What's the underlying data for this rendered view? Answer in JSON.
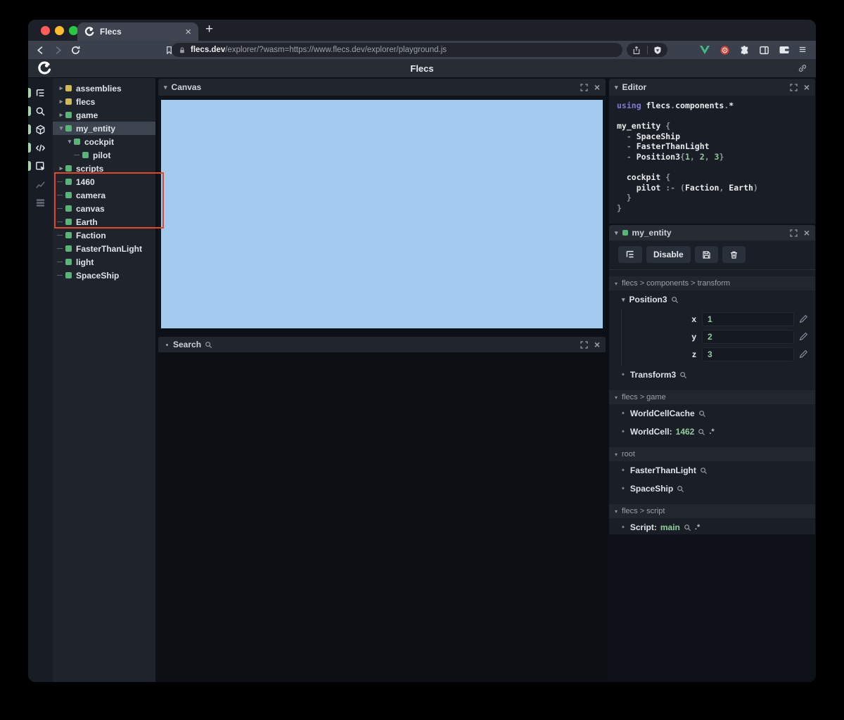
{
  "browser": {
    "tab_title": "Flecs",
    "url_domain": "flecs.dev",
    "url_path": "/explorer/?wasm=https://www.flecs.dev/explorer/playground.js"
  },
  "icons": {
    "close": "×",
    "new_tab": "+",
    "menu": "≡",
    "collapsed_arrow": "▸",
    "expanded_arrow": "▾",
    "bullet": "•",
    "names": [
      "flecs-logo-icon",
      "back-icon",
      "forward-icon",
      "reload-icon",
      "bookmark-icon",
      "lock-icon",
      "share-icon",
      "shield-icon",
      "vue-extension-icon",
      "red-extension-icon",
      "puzzle-icon",
      "sidebar-toggle-icon",
      "wallet-icon",
      "menu-icon",
      "link-icon",
      "tree-icon",
      "search-icon",
      "cube-icon",
      "code-icon",
      "inspector-icon",
      "chart-icon",
      "logs-icon",
      "fullscreen-icon",
      "close-icon",
      "magnifier-icon",
      "pencil-icon",
      "save-icon",
      "trash-icon"
    ]
  },
  "colors": {
    "canvas_blue": "#a3cbf0",
    "annotation_red": "#e0482e",
    "square_green": "#57b578",
    "square_yellow": "#d3ba50",
    "value_green": "#93cb9f",
    "keyword_purple": "#8478cf",
    "vue_green": "#42b883",
    "traffic_red": "#ff5e57",
    "traffic_yellow": "#fdbc2e",
    "traffic_green": "#2ac840"
  },
  "app": {
    "header": {
      "title": "Flecs"
    },
    "tree": {
      "items": [
        {
          "label": "assemblies",
          "square": "yellow",
          "state": "collapsed",
          "indent": 0
        },
        {
          "label": "flecs",
          "square": "yellow",
          "state": "collapsed",
          "indent": 0
        },
        {
          "label": "game",
          "square": "green",
          "state": "collapsed",
          "indent": 0
        },
        {
          "label": "my_entity",
          "square": "green",
          "state": "expanded",
          "indent": 0,
          "selected": true
        },
        {
          "label": "cockpit",
          "square": "green",
          "state": "expanded",
          "indent": 1
        },
        {
          "label": "pilot",
          "square": "green",
          "state": "leaf",
          "indent": 2
        },
        {
          "label": "scripts",
          "square": "green",
          "state": "collapsed",
          "indent": 0
        },
        {
          "label": "1460",
          "square": "green",
          "state": "leaf",
          "indent": 0
        },
        {
          "label": "camera",
          "square": "green",
          "state": "leaf",
          "indent": 0
        },
        {
          "label": "canvas",
          "square": "green",
          "state": "leaf",
          "indent": 0
        },
        {
          "label": "Earth",
          "square": "green",
          "state": "leaf",
          "indent": 0
        },
        {
          "label": "Faction",
          "square": "green",
          "state": "leaf",
          "indent": 0
        },
        {
          "label": "FasterThanLight",
          "square": "green",
          "state": "leaf",
          "indent": 0
        },
        {
          "label": "light",
          "square": "green",
          "state": "leaf",
          "indent": 0
        },
        {
          "label": "SpaceShip",
          "square": "green",
          "state": "leaf",
          "indent": 0
        }
      ]
    },
    "canvas_panel": {
      "title": "Canvas"
    },
    "search_panel": {
      "title": "Search"
    },
    "editor_panel": {
      "title": "Editor",
      "lines": [
        [
          [
            "using ",
            "kw"
          ],
          [
            "flecs",
            "id"
          ],
          [
            ".",
            "pn"
          ],
          [
            "components",
            "id"
          ],
          [
            ".",
            "pn"
          ],
          [
            "*",
            "id"
          ]
        ],
        [],
        [
          [
            "my_entity ",
            "id"
          ],
          [
            "{",
            "pn"
          ]
        ],
        [
          [
            "  - ",
            "pn"
          ],
          [
            "SpaceShip",
            "id"
          ]
        ],
        [
          [
            "  - ",
            "pn"
          ],
          [
            "FasterThanLight",
            "id"
          ]
        ],
        [
          [
            "  - ",
            "pn"
          ],
          [
            "Position3",
            "id"
          ],
          [
            "{",
            "pn"
          ],
          [
            "1",
            "num"
          ],
          [
            ", ",
            "pn"
          ],
          [
            "2",
            "num"
          ],
          [
            ", ",
            "pn"
          ],
          [
            "3",
            "num"
          ],
          [
            "}",
            "pn"
          ]
        ],
        [],
        [
          [
            "  ",
            "pn"
          ],
          [
            "cockpit ",
            "id"
          ],
          [
            "{",
            "pn"
          ]
        ],
        [
          [
            "    ",
            "pn"
          ],
          [
            "pilot ",
            "id"
          ],
          [
            ":- ",
            "pn"
          ],
          [
            "(",
            "pn"
          ],
          [
            "Faction",
            "id"
          ],
          [
            ", ",
            "pn"
          ],
          [
            "Earth",
            "id"
          ],
          [
            ")",
            "pn"
          ]
        ],
        [
          [
            "  }",
            "pn"
          ]
        ],
        [
          [
            "}",
            "pn"
          ]
        ]
      ]
    },
    "inspector": {
      "title": "my_entity",
      "toolbar": {
        "disable_label": "Disable"
      },
      "pair_glyph": ".*",
      "sections": [
        {
          "header": "flecs > components > transform",
          "items": [
            {
              "kind": "expanded",
              "name": "Position3",
              "search": true,
              "fields": [
                {
                  "label": "x",
                  "value": "1"
                },
                {
                  "label": "y",
                  "value": "2"
                },
                {
                  "label": "z",
                  "value": "3"
                }
              ]
            },
            {
              "kind": "bullet",
              "name": "Transform3",
              "search": true
            }
          ]
        },
        {
          "header": "flecs > game",
          "items": [
            {
              "kind": "bullet",
              "name": "WorldCellCache",
              "search": true
            },
            {
              "kind": "bullet",
              "name": "WorldCell:",
              "value": "1462",
              "search": true,
              "pair": true
            }
          ]
        },
        {
          "header": "root",
          "items": [
            {
              "kind": "bullet",
              "name": "FasterThanLight",
              "search": true
            },
            {
              "kind": "bullet",
              "name": "SpaceShip",
              "search": true
            }
          ]
        },
        {
          "header": "flecs > script",
          "items": [
            {
              "kind": "bullet",
              "name": "Script:",
              "value": "main",
              "search": true,
              "pair": true
            }
          ]
        }
      ]
    }
  }
}
